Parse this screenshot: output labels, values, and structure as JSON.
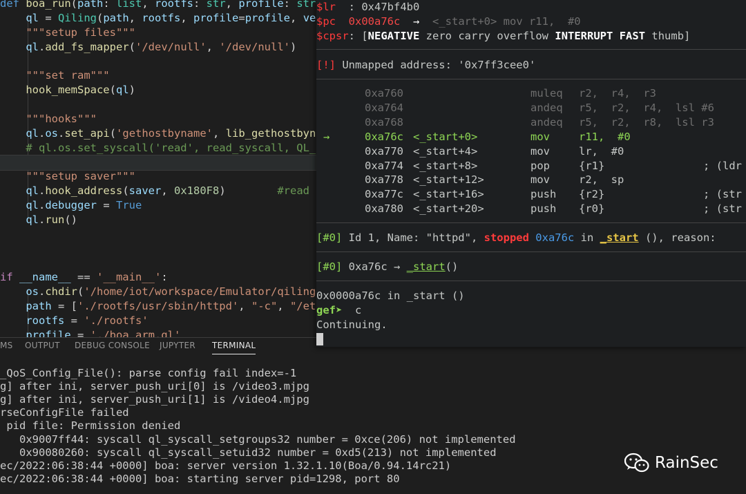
{
  "editor": {
    "lines": [
      {
        "segs": [
          [
            "kw",
            "def "
          ],
          [
            "fn",
            "boa_run"
          ],
          [
            "",
            "("
          ],
          [
            "var",
            "path"
          ],
          [
            "",
            ": "
          ],
          [
            "ty",
            "list"
          ],
          [
            "",
            ", "
          ],
          [
            "var",
            "rootfs"
          ],
          [
            "",
            ": "
          ],
          [
            "ty",
            "str"
          ],
          [
            "",
            ", "
          ],
          [
            "var",
            "profile"
          ],
          [
            "",
            ": "
          ],
          [
            "ty",
            "str"
          ]
        ]
      },
      {
        "segs": [
          [
            "",
            "    "
          ],
          [
            "var",
            "ql"
          ],
          [
            "",
            " = "
          ],
          [
            "ty",
            "Qiling"
          ],
          [
            "",
            "("
          ],
          [
            "var",
            "path"
          ],
          [
            "",
            ", "
          ],
          [
            "var",
            "rootfs"
          ],
          [
            "",
            ", "
          ],
          [
            "var",
            "profile"
          ],
          [
            "",
            "="
          ],
          [
            "var",
            "profile"
          ],
          [
            "",
            ", "
          ],
          [
            "var",
            "ve"
          ]
        ]
      },
      {
        "segs": [
          [
            "",
            "    "
          ],
          [
            "str",
            "\"\"\"setup files\"\"\""
          ]
        ]
      },
      {
        "segs": [
          [
            "",
            "    "
          ],
          [
            "var",
            "ql"
          ],
          [
            "",
            "."
          ],
          [
            "fn",
            "add_fs_mapper"
          ],
          [
            "",
            "("
          ],
          [
            "str",
            "'/dev/null'"
          ],
          [
            "",
            ", "
          ],
          [
            "str",
            "'/dev/null'"
          ],
          [
            "",
            ")"
          ]
        ]
      },
      {
        "segs": [
          [
            "",
            ""
          ]
        ]
      },
      {
        "segs": [
          [
            "",
            "    "
          ],
          [
            "str",
            "\"\"\"set ram\"\"\""
          ]
        ]
      },
      {
        "segs": [
          [
            "",
            "    "
          ],
          [
            "fn",
            "hook_memSpace"
          ],
          [
            "",
            "("
          ],
          [
            "var",
            "ql"
          ],
          [
            "",
            ")"
          ]
        ]
      },
      {
        "segs": [
          [
            "",
            ""
          ]
        ]
      },
      {
        "segs": [
          [
            "",
            "    "
          ],
          [
            "str",
            "\"\"\"hooks\"\"\""
          ]
        ]
      },
      {
        "segs": [
          [
            "",
            "    "
          ],
          [
            "var",
            "ql"
          ],
          [
            "",
            "."
          ],
          [
            "var",
            "os"
          ],
          [
            "",
            "."
          ],
          [
            "fn",
            "set_api"
          ],
          [
            "",
            "("
          ],
          [
            "str",
            "'gethostbyname'"
          ],
          [
            "",
            ", "
          ],
          [
            "fn",
            "lib_gethostbyna"
          ]
        ]
      },
      {
        "segs": [
          [
            "",
            "    "
          ],
          [
            "cm",
            "# ql.os.set_syscall('read', read_syscall, QL_I"
          ]
        ]
      },
      {
        "segs": [
          [
            "",
            ""
          ]
        ]
      },
      {
        "segs": [
          [
            "",
            "    "
          ],
          [
            "str",
            "\"\"\"setup saver\"\"\""
          ]
        ]
      },
      {
        "segs": [
          [
            "",
            "    "
          ],
          [
            "var",
            "ql"
          ],
          [
            "",
            "."
          ],
          [
            "fn",
            "hook_address"
          ],
          [
            "",
            "("
          ],
          [
            "var",
            "saver"
          ],
          [
            "",
            ", "
          ],
          [
            "num",
            "0x180F8"
          ],
          [
            "",
            ")        "
          ],
          [
            "cm",
            "#read t"
          ]
        ]
      },
      {
        "segs": [
          [
            "",
            "    "
          ],
          [
            "var",
            "ql"
          ],
          [
            "",
            "."
          ],
          [
            "var",
            "debugger"
          ],
          [
            "",
            " = "
          ],
          [
            "kw",
            "True"
          ]
        ]
      },
      {
        "segs": [
          [
            "",
            "    "
          ],
          [
            "var",
            "ql"
          ],
          [
            "",
            "."
          ],
          [
            "fn",
            "run"
          ],
          [
            "",
            "()"
          ]
        ]
      },
      {
        "segs": [
          [
            "",
            ""
          ]
        ]
      },
      {
        "segs": [
          [
            "",
            ""
          ]
        ]
      },
      {
        "segs": [
          [
            "",
            ""
          ]
        ]
      },
      {
        "segs": [
          [
            "ctl",
            "if "
          ],
          [
            "var",
            "__name__"
          ],
          [
            "",
            " == "
          ],
          [
            "str",
            "'__main__'"
          ],
          [
            "",
            ":"
          ]
        ]
      },
      {
        "segs": [
          [
            "",
            "    "
          ],
          [
            "var",
            "os"
          ],
          [
            "",
            "."
          ],
          [
            "fn",
            "chdir"
          ],
          [
            "",
            "("
          ],
          [
            "str",
            "'/home/iot/workspace/Emulator/qiling"
          ]
        ]
      },
      {
        "segs": [
          [
            "",
            "    "
          ],
          [
            "var",
            "path"
          ],
          [
            "",
            " = ["
          ],
          [
            "str",
            "'./rootfs/usr/sbin/httpd'"
          ],
          [
            "",
            ", "
          ],
          [
            "str",
            "\"-c\""
          ],
          [
            "",
            ", "
          ],
          [
            "str",
            "\"/etc"
          ]
        ]
      },
      {
        "segs": [
          [
            "",
            "    "
          ],
          [
            "var",
            "rootfs"
          ],
          [
            "",
            " = "
          ],
          [
            "str",
            "'./rootfs'"
          ]
        ]
      },
      {
        "segs": [
          [
            "",
            "    "
          ],
          [
            "var",
            "profile"
          ],
          [
            "",
            " = "
          ],
          [
            "str",
            "'./boa_arm.ql'"
          ]
        ]
      }
    ]
  },
  "panel": {
    "tabs": [
      "MS",
      "OUTPUT",
      "DEBUG CONSOLE",
      "JUPYTER",
      "TERMINAL"
    ],
    "active_tab": "TERMINAL",
    "terminal_lines": [
      "_QoS_Config_File(): parse config fail index=-1",
      "g] after ini, server_push_uri[0] is /video3.mjpg",
      "g] after ini, server_push_uri[1] is /video4.mjpg",
      "rseConfigFile failed",
      " pid file: Permission denied",
      "   0x9007ff44: syscall ql_syscall_setgroups32 number = 0xce(206) not implemented",
      "   0x90080260: syscall ql_syscall_setuid32 number = 0xd5(213) not implemented",
      "ec/2022:06:38:44 +0000] boa: server version 1.32.1.10(Boa/0.94.14rc21)",
      "ec/2022:06:38:44 +0000] boa: starting server pid=1298, port 80"
    ]
  },
  "gef": {
    "reg_lr": {
      "name": "$lr ",
      "value": " : 0x47bf4b0"
    },
    "reg_pc": {
      "name": "$pc ",
      "value": "0x00a76c",
      "arrow": "  →  ",
      "dis": "<_start+0> mov r11,  #0"
    },
    "reg_cpsr": {
      "name": "$cpsr",
      "flags": [
        [
          "b",
          "NEGATIVE"
        ],
        [
          "n",
          "zero"
        ],
        [
          "n",
          "carry"
        ],
        [
          "n",
          "overflow"
        ],
        [
          "b",
          "INTERRUPT"
        ],
        [
          "b",
          "FAST"
        ],
        [
          "n",
          "thumb"
        ]
      ]
    },
    "warning_tag": "[!]",
    "warning_text": " Unmapped address: '0x7ff3cee0'",
    "code": [
      {
        "addr": "0xa760",
        "sym": "",
        "mn": "muleq",
        "ops": "r2,  r4,  r3",
        "cm": "",
        "state": "past"
      },
      {
        "addr": "0xa764",
        "sym": "",
        "mn": "andeq",
        "ops": "r5,  r2,  r4,  lsl #6",
        "cm": "",
        "state": "past"
      },
      {
        "addr": "0xa768",
        "sym": "",
        "mn": "andeq",
        "ops": "r5,  r2,  r8,  lsl r3",
        "cm": "",
        "state": "past"
      },
      {
        "addr": "0xa76c",
        "sym": "<_start+0>",
        "mn": "mov",
        "ops": "r11,  #0",
        "cm": "",
        "state": "current"
      },
      {
        "addr": "0xa770",
        "sym": "<_start+4>",
        "mn": "mov",
        "ops": "lr,  #0",
        "cm": "",
        "state": "next"
      },
      {
        "addr": "0xa774",
        "sym": "<_start+8>",
        "mn": "pop",
        "ops": "{r1}",
        "cm": "; (ldr",
        "state": "next"
      },
      {
        "addr": "0xa778",
        "sym": "<_start+12>",
        "mn": "mov",
        "ops": "r2,  sp",
        "cm": "",
        "state": "next"
      },
      {
        "addr": "0xa77c",
        "sym": "<_start+16>",
        "mn": "push",
        "ops": "{r2}",
        "cm": "; (str",
        "state": "next"
      },
      {
        "addr": "0xa780",
        "sym": "<_start+20>",
        "mn": "push",
        "ops": "{r0}",
        "cm": "; (str",
        "state": "next"
      }
    ],
    "current_arrow": "→",
    "thread": {
      "tag": "[#0]",
      "text1": " Id 1, Name: \"httpd\", ",
      "state": "stopped",
      "addr": " 0xa76c",
      "in": " in ",
      "fn": "_start",
      "rest": " (), reason:"
    },
    "trace": {
      "tag": "[#0]",
      "addr": " 0xa76c → ",
      "fn": "_start",
      "rest": "()"
    },
    "location": "0x0000a76c in _start ()",
    "prompt": "gef➤",
    "command": "  c",
    "status": "Continuing."
  },
  "watermark": {
    "text": "RainSec",
    "icon": "wechat-icon"
  }
}
